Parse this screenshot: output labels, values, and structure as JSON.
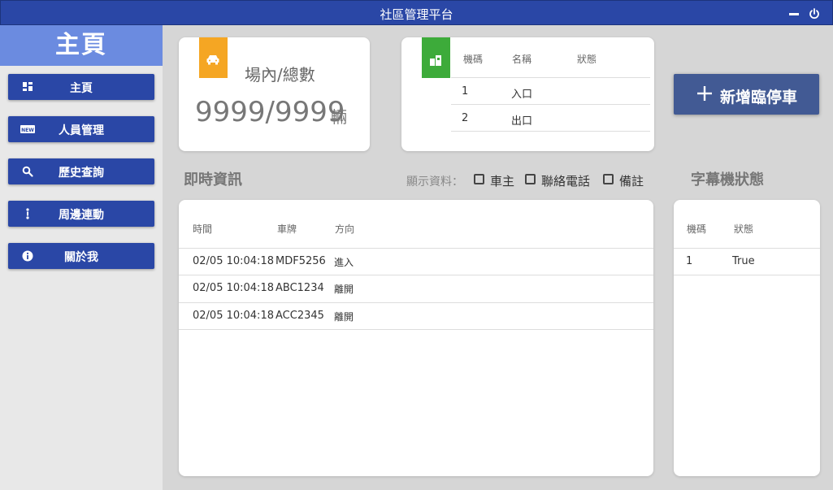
{
  "window": {
    "title": "社區管理平台",
    "minimize_icon": "minimize-icon",
    "power_icon": "power-icon"
  },
  "sidebar": {
    "heading": "主頁",
    "items": [
      {
        "label": "主頁",
        "icon": "dashboard-icon"
      },
      {
        "label": "人員管理",
        "icon": "new-badge-icon"
      },
      {
        "label": "歷史查詢",
        "icon": "search-icon"
      },
      {
        "label": "周邊連動",
        "icon": "vertical-dots-icon"
      },
      {
        "label": "關於我",
        "icon": "info-icon"
      }
    ]
  },
  "parking": {
    "icon": "car-icon",
    "label": "場內/總數",
    "value": "9999/9999",
    "unit": "輛"
  },
  "gates": {
    "icon": "gate-icon",
    "headers": [
      "機碼",
      "名稱",
      "狀態"
    ],
    "rows": [
      {
        "id": "1",
        "name": "入口",
        "status": ""
      },
      {
        "id": "2",
        "name": "出口",
        "status": ""
      }
    ]
  },
  "add_button": {
    "label": "新增臨停車"
  },
  "realtime": {
    "title": "即時資訊",
    "display_label": "顯示資料：",
    "options": [
      "車主",
      "聯絡電話",
      "備註"
    ],
    "headers": [
      "時間",
      "車牌",
      "方向"
    ],
    "rows": [
      {
        "time": "02/05 10:04:18",
        "plate": "MDF5256",
        "direction": "進入"
      },
      {
        "time": "02/05 10:04:18",
        "plate": "ABC1234",
        "direction": "離開"
      },
      {
        "time": "02/05 10:04:18",
        "plate": "ACC2345",
        "direction": "離開"
      }
    ]
  },
  "marquee": {
    "title": "字幕機狀態",
    "headers": [
      "機碼",
      "狀態"
    ],
    "rows": [
      {
        "id": "1",
        "status": "True"
      }
    ]
  },
  "colors": {
    "primary": "#2a47a6",
    "sidebar_head": "#6b8be0",
    "parking_badge": "#f5a623",
    "gate_badge": "#3dab3a",
    "add_button": "#425a94"
  }
}
